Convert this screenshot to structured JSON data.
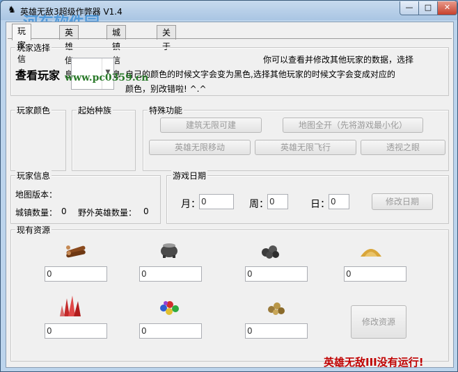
{
  "window": {
    "title": "英雄无敌3超级作弊器 V1.4",
    "watermark_logo": "河东软件园",
    "watermark_url": "www.pc0359.cn",
    "buttons": {
      "minimize": "—",
      "maximize": "□",
      "close": "✕"
    }
  },
  "tabs": [
    {
      "label": "玩家信息",
      "active": true
    },
    {
      "label": "英雄信息",
      "active": false
    },
    {
      "label": "城镇信息",
      "active": false
    },
    {
      "label": "关于",
      "active": false
    }
  ],
  "player_select": {
    "legend": "玩家选择",
    "view_label": "查看玩家",
    "dropdown_value": "",
    "description_line1": "你可以查看并修改其他玩家的数据，选择",
    "description_line2": "自己的颜色的时候文字会变为黑色,选择其他玩家的时候文字会变成对应的",
    "description_line3": "颜色，别改错啦! ^.^"
  },
  "player_color": {
    "legend": "玩家颜色"
  },
  "starting_race": {
    "legend": "起始种族"
  },
  "special": {
    "legend": "特殊功能",
    "build_unlimited": "建筑无限可建",
    "map_reveal": "地图全开（先将游戏最小化）",
    "hero_unlimited_move": "英雄无限移动",
    "hero_unlimited_fly": "英雄无限飞行",
    "see_through": "透视之眼"
  },
  "player_info": {
    "legend": "玩家信息",
    "map_version_label": "地图版本：",
    "town_count_label": "城镇数量：",
    "town_count": "0",
    "wild_hero_label": "野外英雄数量：",
    "wild_hero_count": "0"
  },
  "game_date": {
    "legend": "游戏日期",
    "month_label": "月：",
    "month_value": "0",
    "week_label": "周：",
    "week_value": "0",
    "day_label": "日：",
    "day_value": "0",
    "modify_button": "修改日期"
  },
  "resources": {
    "legend": "现有资源",
    "items": [
      {
        "icon": "wood-icon",
        "value": "0"
      },
      {
        "icon": "mercury-icon",
        "value": "0"
      },
      {
        "icon": "ore-icon",
        "value": "0"
      },
      {
        "icon": "sulfur-icon",
        "value": "0"
      },
      {
        "icon": "crystal-icon",
        "value": "0"
      },
      {
        "icon": "gems-icon",
        "value": "0"
      },
      {
        "icon": "gold-icon",
        "value": "0"
      }
    ],
    "modify_button": "修改资源"
  },
  "status": {
    "text": "英雄无敌III没有运行!",
    "color": "#c00000"
  }
}
